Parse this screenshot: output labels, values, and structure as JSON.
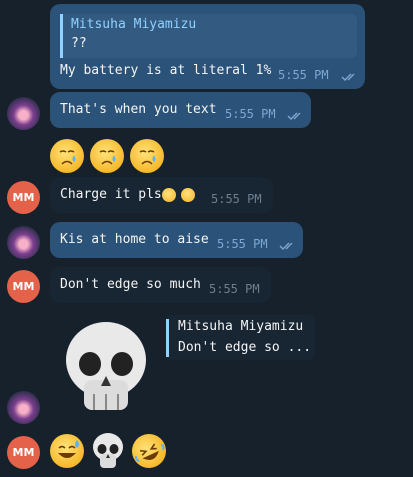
{
  "messages": {
    "m1": {
      "reply_name": "Mitsuha Miyamizu",
      "reply_text": "??",
      "text": "My battery is at literal 1%",
      "time": "5:55 PM"
    },
    "m2": {
      "text": "That's when you text",
      "time": "5:55 PM"
    },
    "m3": {
      "emojis": [
        "crying-face-icon",
        "crying-face-icon",
        "crying-face-icon"
      ]
    },
    "m4": {
      "avatar": "MM",
      "text": "Charge it pls",
      "time": "5:55 PM"
    },
    "m5": {
      "text": "Kis at home to aise",
      "time": "5:55 PM"
    },
    "m6": {
      "avatar": "MM",
      "text": "Don't edge so much",
      "time": "5:55 PM"
    },
    "m7": {
      "reply_name": "Mitsuha Miyamizu",
      "reply_text": "Don't edge so ...",
      "sticker": "skull-icon"
    },
    "m8": {
      "avatar": "MM",
      "emojis": [
        "sweat-smile-icon",
        "skull-icon",
        "rofl-icon"
      ]
    }
  },
  "colors": {
    "background": "#17212b",
    "outgoing_bubble": "#2b5278",
    "incoming_bubble": "#182533",
    "reply_accent": "#8fd1ff",
    "avatar_mm": "#e5624a"
  }
}
